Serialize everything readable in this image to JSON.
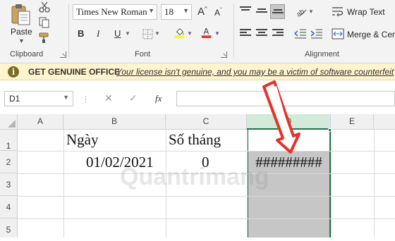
{
  "ribbon": {
    "clipboard": {
      "paste_label": "Paste",
      "group_label": "Clipboard"
    },
    "font": {
      "font_name": "Times New Roman",
      "font_size": "18",
      "group_label": "Font",
      "bold_label": "B",
      "italic_label": "I",
      "underline_label": "U",
      "grow_label": "A",
      "shrink_label": "A"
    },
    "alignment": {
      "wrap_text_label": "Wrap Text",
      "merge_label": "Merge & Cen",
      "group_label": "Alignment"
    }
  },
  "genuine_bar": {
    "icon": "i",
    "title": "GET GENUINE OFFICE",
    "message": "Your license isn't genuine, and you may be a victim of software counterfeit"
  },
  "formula_bar": {
    "name_box": "D1",
    "cancel_symbol": "✕",
    "enter_symbol": "✓",
    "fx_label": "fx",
    "formula_value": ""
  },
  "sheet": {
    "columns": [
      "A",
      "B",
      "C",
      "D",
      "E"
    ],
    "rows": [
      "1",
      "2",
      "3",
      "4",
      "5"
    ],
    "cells": {
      "B1": "Ngày",
      "C1": "Số tháng",
      "B2": "01/02/2021",
      "C2": "0",
      "D2": "#########"
    },
    "selected_column": "D"
  },
  "watermark": "Quantrimang",
  "colors": {
    "excel_green": "#217346",
    "annotation_red": "#e8302a",
    "genuine_bar": "#fff4ce"
  }
}
